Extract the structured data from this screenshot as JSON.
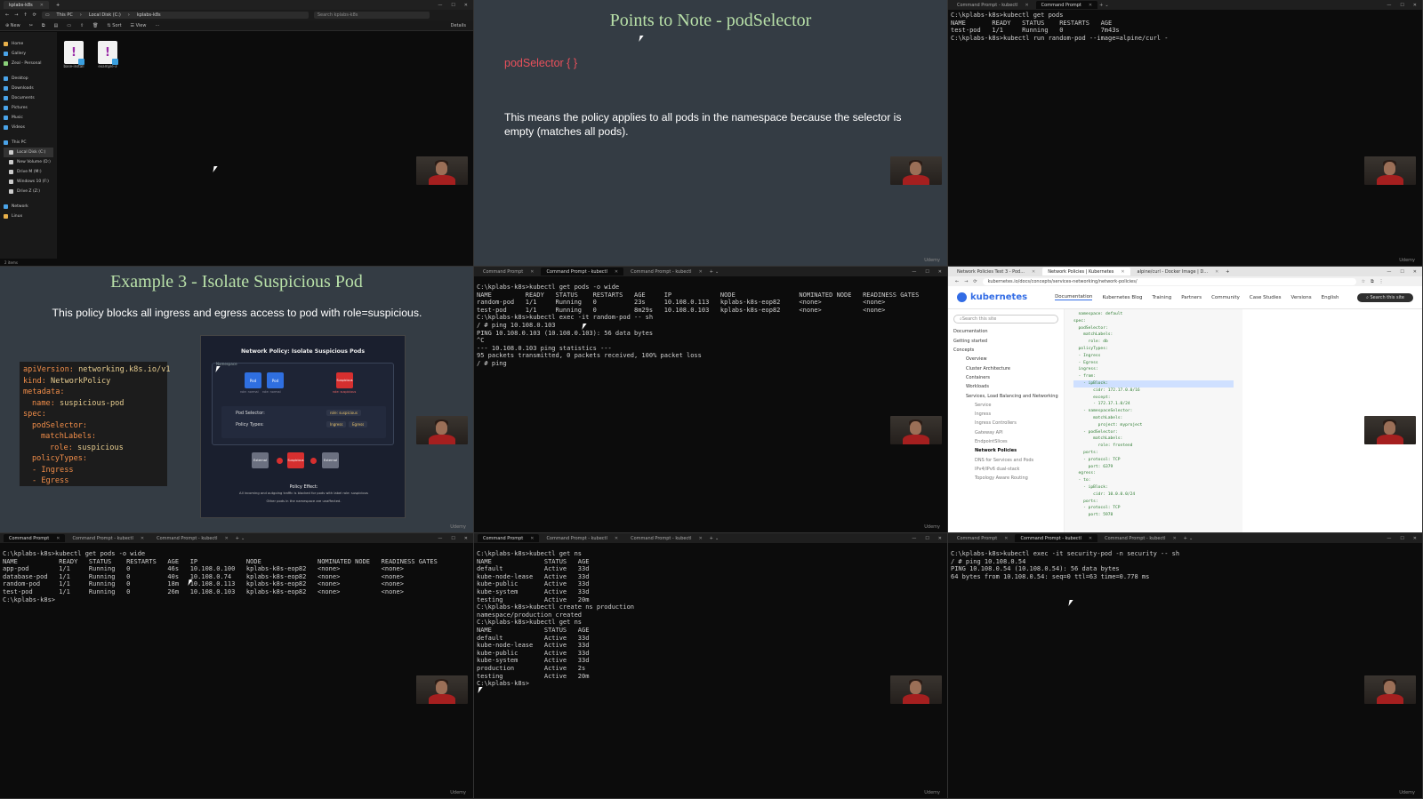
{
  "panel1": {
    "window_title": "kplabs-k8s",
    "breadcrumb": [
      "This PC",
      "Local Disk (C:)",
      "kplabs-k8s"
    ],
    "search_placeholder": "Search kplabs-k8s",
    "toolbar": [
      "New",
      "Sort",
      "View",
      "Details"
    ],
    "sidebar": [
      "Home",
      "Gallery",
      "Zeal - Personal",
      "Desktop",
      "Downloads",
      "Documents",
      "Pictures",
      "Music",
      "Videos",
      "This PC",
      "Local Disk (C:)",
      "New Volume (D:)",
      "Drive M (M:)",
      "Windows 10 (F:)",
      "Drive Z (Z:)",
      "Network",
      "Linux"
    ],
    "files": [
      "base-install",
      "example-3"
    ],
    "status": "2 items"
  },
  "panel2": {
    "title": "Points to Note - podSelector",
    "code": "podSelector { }",
    "body": "This means the policy applies to all pods in the namespace because the selector is empty (matches all pods).",
    "watermark": "Udemy"
  },
  "panel3": {
    "tabs": [
      "Command Prompt - kubectl",
      "Command Prompt"
    ],
    "lines": [
      "C:\\kplabs-k8s>kubectl get pods",
      "NAME       READY   STATUS    RESTARTS   AGE",
      "test-pod   1/1     Running   0          7m43s",
      "",
      "C:\\kplabs-k8s>kubectl run random-pod --image=alpine/curl -"
    ],
    "watermark": "Udemy"
  },
  "panel4": {
    "title": "Example 3 - Isolate Suspicious Pod",
    "subtitle": "This policy blocks all ingress and egress access to pod with role=suspicious.",
    "yaml": [
      {
        "k": "apiVersion:",
        "v": " networking.k8s.io/v1",
        "i": 0
      },
      {
        "k": "kind:",
        "v": " NetworkPolicy",
        "i": 0
      },
      {
        "k": "metadata:",
        "v": "",
        "i": 0
      },
      {
        "k": "name:",
        "v": " suspicious-pod",
        "i": 2
      },
      {
        "k": "spec:",
        "v": "",
        "i": 0
      },
      {
        "k": "podSelector:",
        "v": "",
        "i": 2
      },
      {
        "k": "matchLabels:",
        "v": "",
        "i": 4
      },
      {
        "k": "role:",
        "v": " suspicious",
        "i": 6
      },
      {
        "k": "policyTypes:",
        "v": "",
        "i": 2
      },
      {
        "k": "- Ingress",
        "v": "",
        "i": 2
      },
      {
        "k": "- Egress",
        "v": "",
        "i": 2
      }
    ],
    "diagram": {
      "title": "Network Policy: Isolate Suspicious Pods",
      "namespace_label": "Namespace",
      "pod1": "Pod",
      "pod2": "Pod",
      "pod3": "Suspicious",
      "pod1_sub": "role: normal",
      "pod2_sub": "role: normal",
      "pod3_sub": "role: suspicious",
      "selector_label": "Pod Selector:",
      "selector_value": "role: suspicious",
      "types_label": "Policy Types:",
      "type_ingress": "Ingress",
      "type_egress": "Egress",
      "external1": "External",
      "center": "Suspicious",
      "external2": "External",
      "effect_title": "Policy Effect:",
      "effect_line1": "All incoming and outgoing traffic is blocked for pods with label role: suspicious",
      "effect_line2": "Other pods in the namespace are unaffected."
    },
    "watermark": "Udemy"
  },
  "panel5": {
    "tabs": [
      "Command Prompt",
      "Command Prompt - kubectl",
      "Command Prompt - kubectl"
    ],
    "lines": [
      "C:\\kplabs-k8s>kubectl get pods -o wide",
      "NAME         READY   STATUS    RESTARTS   AGE     IP             NODE                 NOMINATED NODE   READINESS GATES",
      "random-pod   1/1     Running   0          23s     10.108.0.113   kplabs-k8s-eop82     <none>           <none>",
      "test-pod     1/1     Running   0          8m29s   10.108.0.103   kplabs-k8s-eop82     <none>           <none>",
      "",
      "C:\\kplabs-k8s>kubectl exec -it random-pod -- sh",
      "/ # ping 10.108.0.103",
      "PING 10.108.0.103 (10.108.0.103): 56 data bytes",
      "^C",
      "--- 10.108.0.103 ping statistics ---",
      "95 packets transmitted, 0 packets received, 100% packet loss",
      "/ # ping"
    ],
    "watermark": "Udemy"
  },
  "panel6": {
    "tabs": [
      "Network Policies Test 3 - Pod...",
      "Network Policies | Kubernetes",
      "alpine/curl - Docker Image | D..."
    ],
    "url": "kubernetes.io/docs/concepts/services-networking/network-policies/",
    "logo": "kubernetes",
    "nav": [
      "Documentation",
      "Kubernetes Blog",
      "Training",
      "Partners",
      "Community",
      "Case Studies",
      "Versions",
      "English"
    ],
    "search": "Search this site",
    "side_search": "Search this site",
    "side": [
      "Documentation",
      "Getting started",
      "Concepts",
      "Overview",
      "Cluster Architecture",
      "Containers",
      "Workloads",
      "Services, Load Balancing and Networking",
      "Service",
      "Ingress",
      "Ingress Controllers",
      "Gateway API",
      "EndpointSlices",
      "Network Policies",
      "DNS for Services and Pods",
      "IPv4/IPv6 dual-stack",
      "Topology Aware Routing"
    ],
    "code": [
      "  namespace: default",
      "spec:",
      "  podSelector:",
      "    matchLabels:",
      "      role: db",
      "  policyTypes:",
      "  - Ingress",
      "  - Egress",
      "  ingress:",
      "  - from:",
      "    - ipBlock:",
      "        cidr: 172.17.0.0/16",
      "        except:",
      "        - 172.17.1.0/24",
      "    - namespaceSelector:",
      "        matchLabels:",
      "          project: myproject",
      "    - podSelector:",
      "        matchLabels:",
      "          role: frontend",
      "    ports:",
      "    - protocol: TCP",
      "      port: 6379",
      "  egress:",
      "  - to:",
      "    - ipBlock:",
      "        cidr: 10.0.0.0/24",
      "    ports:",
      "    - protocol: TCP",
      "      port: 5978"
    ],
    "watermark": "Udemy"
  },
  "panel7": {
    "tabs": [
      "Command Prompt",
      "Command Prompt - kubectl",
      "Command Prompt - kubectl"
    ],
    "lines": [
      "C:\\kplabs-k8s>kubectl get pods -o wide",
      "NAME           READY   STATUS    RESTARTS   AGE   IP             NODE               NOMINATED NODE   READINESS GATES",
      "app-pod        1/1     Running   0          46s   10.108.0.100   kplabs-k8s-eop82   <none>           <none>",
      "database-pod   1/1     Running   0          40s   10.108.0.74    kplabs-k8s-eop82   <none>           <none>",
      "random-pod     1/1     Running   0          18m   10.108.0.113   kplabs-k8s-eop82   <none>           <none>",
      "test-pod       1/1     Running   0          26m   10.108.0.103   kplabs-k8s-eop82   <none>           <none>",
      "",
      "C:\\kplabs-k8s>"
    ],
    "watermark": "Udemy"
  },
  "panel8": {
    "tabs": [
      "Command Prompt",
      "Command Prompt - kubectl",
      "Command Prompt - kubectl"
    ],
    "lines": [
      "C:\\kplabs-k8s>kubectl get ns",
      "NAME              STATUS   AGE",
      "default           Active   33d",
      "kube-node-lease   Active   33d",
      "kube-public       Active   33d",
      "kube-system       Active   33d",
      "testing           Active   20m",
      "",
      "C:\\kplabs-k8s>kubectl create ns production",
      "namespace/production created",
      "",
      "C:\\kplabs-k8s>kubectl get ns",
      "NAME              STATUS   AGE",
      "default           Active   33d",
      "kube-node-lease   Active   33d",
      "kube-public       Active   33d",
      "kube-system       Active   33d",
      "production        Active   2s",
      "testing           Active   20m",
      "",
      "C:\\kplabs-k8s>"
    ],
    "watermark": "Udemy"
  },
  "panel9": {
    "tabs": [
      "Command Prompt",
      "Command Prompt - kubectl",
      "Command Prompt - kubectl"
    ],
    "lines": [
      "C:\\kplabs-k8s>kubectl exec -it security-pod -n security -- sh",
      "/ # ping 10.108.0.54",
      "PING 10.108.0.54 (10.108.0.54): 56 data bytes",
      "64 bytes from 10.108.0.54: seq=0 ttl=63 time=0.778 ms"
    ],
    "watermark": "Udemy"
  },
  "colors": {
    "terminal_bg": "#0c0c0c",
    "slide_bg": "#343c44",
    "slide_title": "#b8e0a8",
    "code_red": "#e8505b",
    "k8s_blue": "#326ce5"
  }
}
